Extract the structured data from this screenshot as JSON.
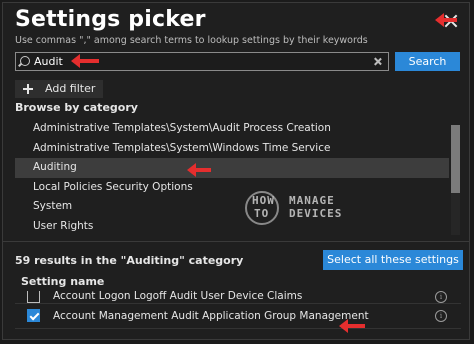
{
  "dialog": {
    "title": "Settings picker",
    "subtitle": "Use commas \",\" among search terms to lookup settings by their keywords",
    "close_icon": "close-icon"
  },
  "search": {
    "value": "Audit",
    "button_label": "Search"
  },
  "filter": {
    "add_filter_label": "Add filter"
  },
  "browse": {
    "heading": "Browse by category",
    "categories": [
      "Administrative Templates\\System\\Audit Process Creation",
      "Administrative Templates\\System\\Windows Time Service",
      "Auditing",
      "Local Policies Security Options",
      "System",
      "User Rights"
    ],
    "selected_index": 2
  },
  "results": {
    "summary": "59 results in the \"Auditing\" category",
    "select_all_label": "Select all these settings",
    "column_header": "Setting name",
    "rows": [
      {
        "label": "Account Logon Logoff Audit User Device Claims",
        "checked": false
      },
      {
        "label": "Account Management Audit Application Group Management",
        "checked": true
      }
    ]
  },
  "watermark": {
    "line1": "HOW",
    "line2": "TO",
    "brand1": "MANAGE",
    "brand2": "DEVICES"
  },
  "colors": {
    "accent": "#2b88d8",
    "annotation_arrow": "#e52e2e",
    "background": "#1f1f1f"
  }
}
